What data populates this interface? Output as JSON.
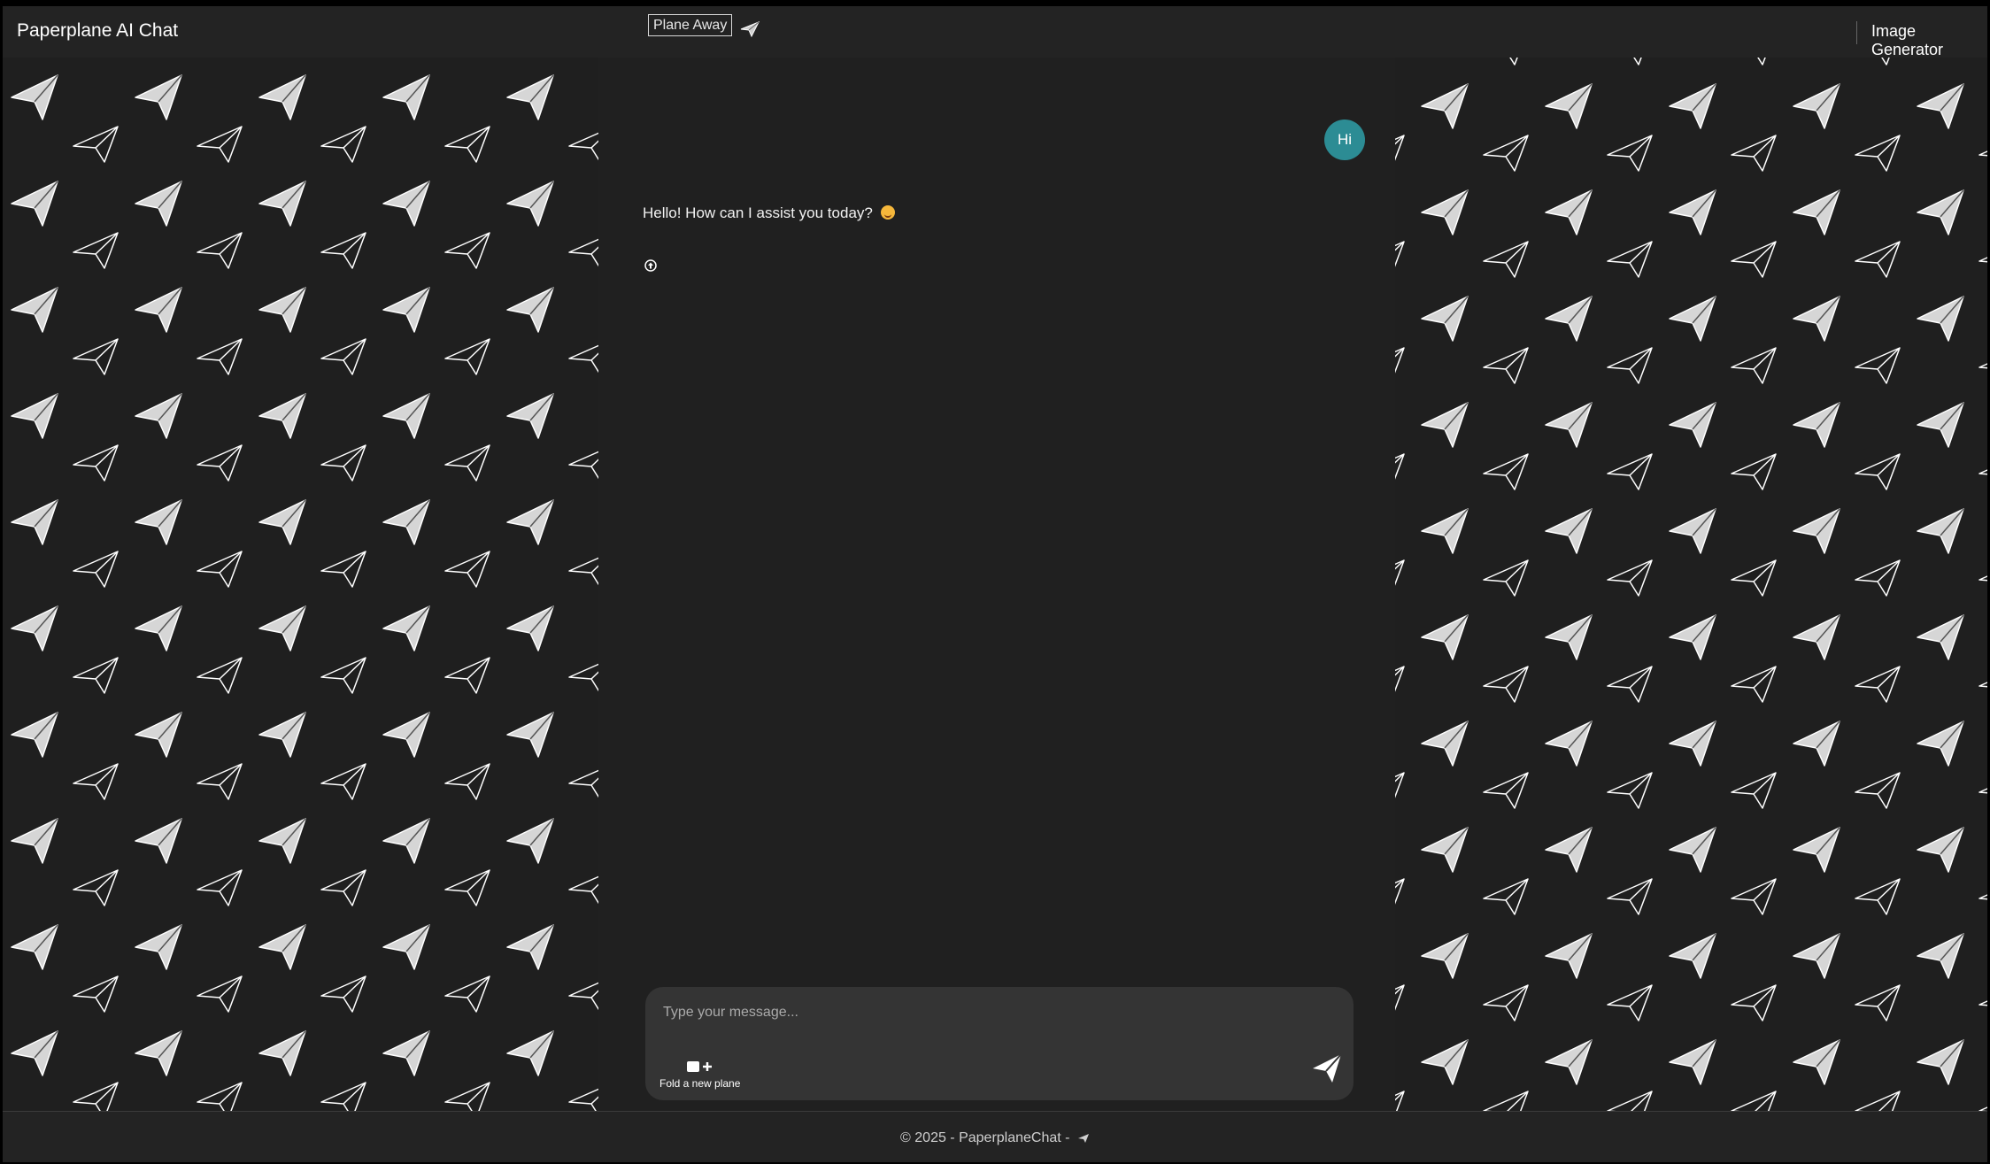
{
  "header": {
    "brand": "Paperplane AI Chat",
    "plane_away": "Plane Away",
    "image_generator": "Image Generator"
  },
  "chat": {
    "user_message": "Hi",
    "assistant_message": "Hello! How can I assist you today?"
  },
  "composer": {
    "placeholder": "Type your message...",
    "fold_label": "Fold a new plane"
  },
  "footer": {
    "text": "© 2025 - PaperplaneChat -"
  },
  "colors": {
    "accent": "#2c8c94",
    "background": "#232323",
    "composer": "#343434"
  },
  "icons": [
    "paper-plane-icon",
    "up-arrow-circle-icon",
    "new-plane-icon",
    "send-icon",
    "smile-emoji-icon"
  ]
}
